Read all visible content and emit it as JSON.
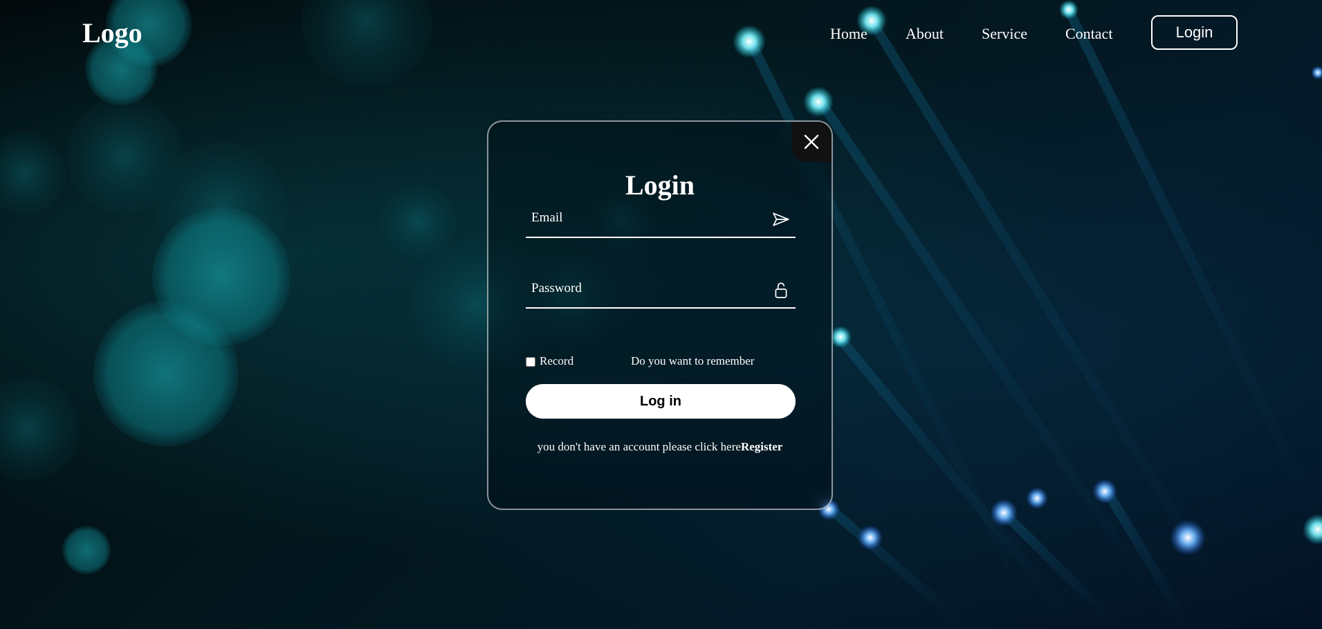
{
  "header": {
    "logo": "Logo",
    "nav": [
      "Home",
      "About",
      "Service",
      "Contact"
    ],
    "login_button": "Login"
  },
  "login_card": {
    "title": "Login",
    "email_placeholder": "Email",
    "email_icon": "send-icon",
    "password_placeholder": "Password",
    "password_icon": "unlock-icon",
    "close_icon": "close-icon",
    "record_label": "Record",
    "record_checked": false,
    "remember_text": "Do you want to remember",
    "submit_label": "Log in",
    "register_prompt": "you don't have an account please click here",
    "register_link": "Register"
  },
  "colors": {
    "background": "#020c12",
    "accent": "#1ab8c4",
    "button_bg": "#ffffff",
    "close_bg": "#111111"
  }
}
